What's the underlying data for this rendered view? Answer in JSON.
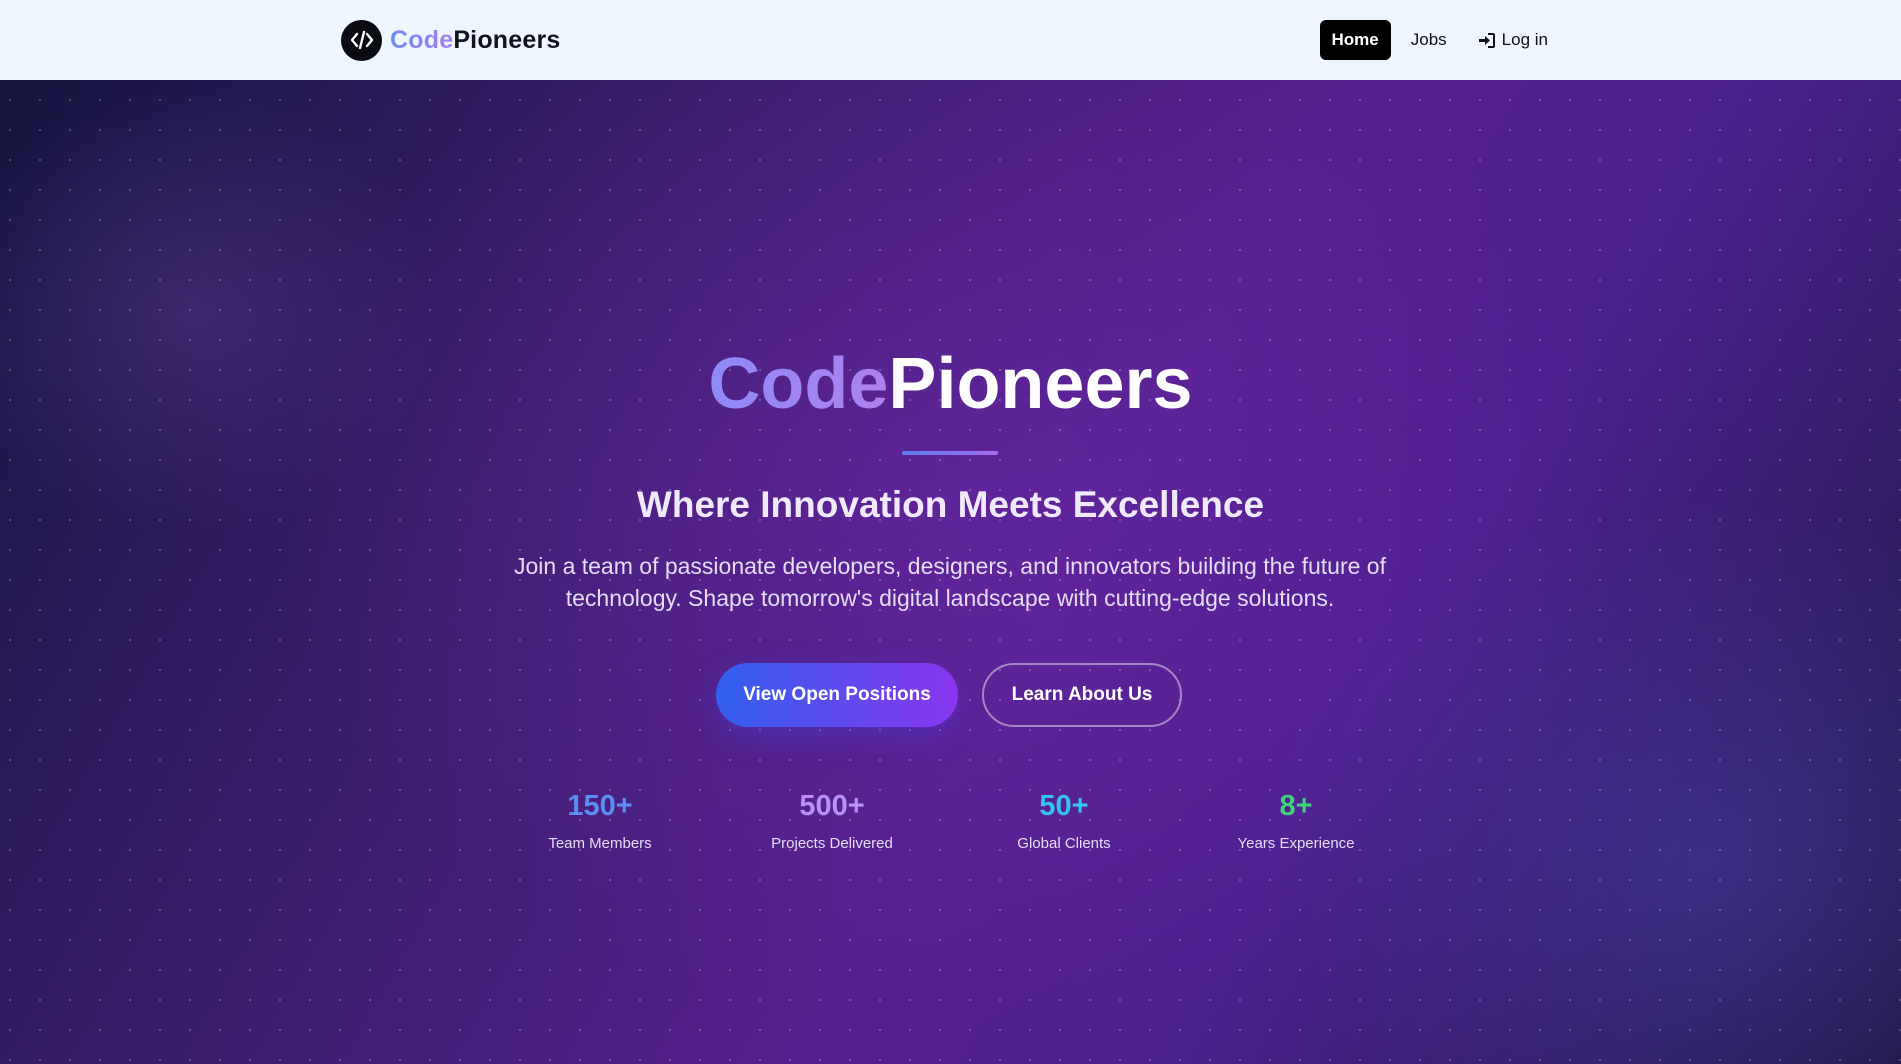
{
  "navbar": {
    "brand": {
      "code": "Code",
      "pioneers": "Pioneers",
      "logo_icon": "code-brackets-icon"
    },
    "links": {
      "home": "Home",
      "jobs": "Jobs",
      "login": "Log in",
      "login_icon": "sign-in-icon"
    }
  },
  "hero": {
    "title_code": "Code",
    "title_pioneers": "Pioneers",
    "subtitle": "Where Innovation Meets Excellence",
    "description": "Join a team of passionate developers, designers, and innovators building the future of technology. Shape tomorrow's digital landscape with cutting-edge solutions.",
    "primary_button": "View Open Positions",
    "secondary_button": "Learn About Us"
  },
  "stats": [
    {
      "value": "150+",
      "label": "Team Members",
      "color": "#5b8ef2"
    },
    {
      "value": "500+",
      "label": "Projects Delivered",
      "color": "#b690f5"
    },
    {
      "value": "50+",
      "label": "Global Clients",
      "color": "#34c3ec"
    },
    {
      "value": "8+",
      "label": "Years Experience",
      "color": "#3fd27a"
    }
  ],
  "colors": {
    "nav_background": "#eef5fd",
    "accent_blue": "#3160ef",
    "accent_purple": "#8a36ee"
  }
}
